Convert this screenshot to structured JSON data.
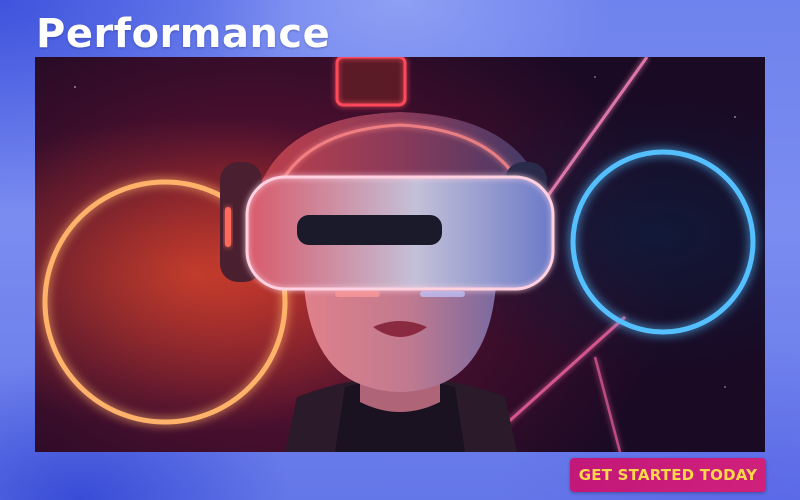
{
  "page": {
    "title": "Performance"
  },
  "cta": {
    "label": "GET STARTED TODAY"
  },
  "colors": {
    "background": "#7185ee",
    "cta_background": "#c81a7b",
    "cta_text": "#ffd84a",
    "neon_orange": "#ff8a3a",
    "neon_blue": "#4fb8ff",
    "neon_pink": "#ff6aa8"
  }
}
